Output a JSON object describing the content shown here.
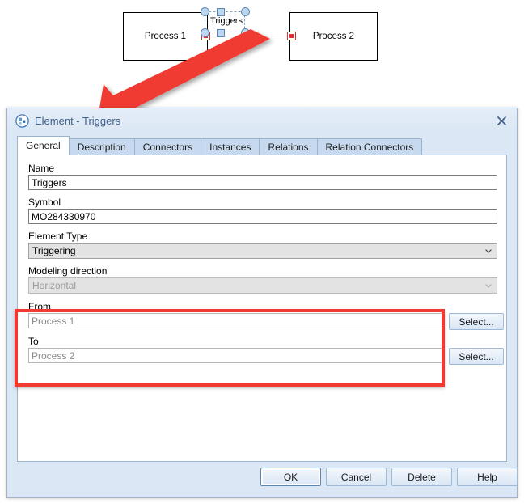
{
  "diagram": {
    "process_from": "Process 1",
    "process_to": "Process 2",
    "connector_label": "Triggers",
    "colors": {
      "endpoint": "#e03030",
      "midpoint_diamond": "#ffd83b",
      "selection_handle": "#bcd8ef",
      "connector_line": "#8a8a8a"
    }
  },
  "annotation": {
    "arrow_color": "#f03a32",
    "highlight_color": "#f03a32"
  },
  "dialog": {
    "title": "Element - Triggers",
    "icon": "element-icon",
    "close_label": "✖",
    "tabs": [
      {
        "label": "General",
        "active": true
      },
      {
        "label": "Description",
        "active": false
      },
      {
        "label": "Connectors",
        "active": false
      },
      {
        "label": "Instances",
        "active": false
      },
      {
        "label": "Relations",
        "active": false
      },
      {
        "label": "Relation Connectors",
        "active": false
      }
    ],
    "form": {
      "name_label": "Name",
      "name_value": "Triggers",
      "symbol_label": "Symbol",
      "symbol_value": "MO284330970",
      "element_type_label": "Element Type",
      "element_type_value": "Triggering",
      "modeling_direction_label": "Modeling direction",
      "modeling_direction_value": "Horizontal",
      "from_label": "From",
      "from_value": "Process 1",
      "from_select_label": "Select...",
      "to_label": "To",
      "to_value": "Process 2",
      "to_select_label": "Select..."
    },
    "footer": {
      "ok_label": "OK",
      "cancel_label": "Cancel",
      "delete_label": "Delete",
      "help_label": "Help"
    }
  }
}
